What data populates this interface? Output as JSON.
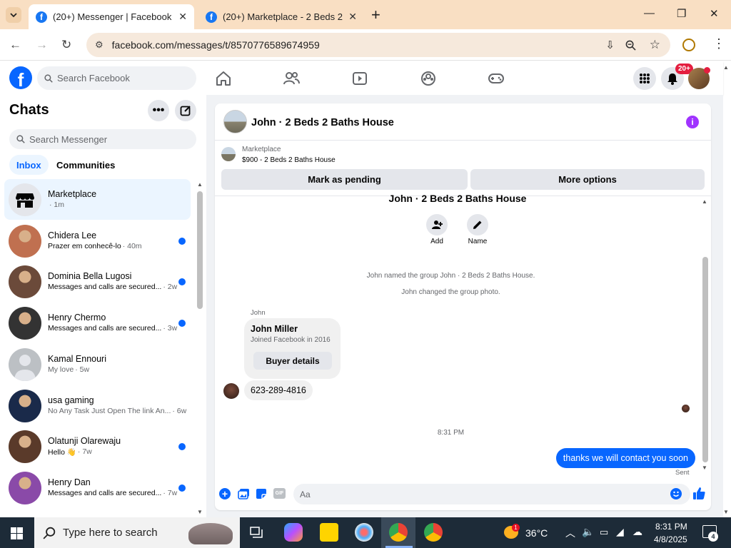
{
  "browser": {
    "tabs": [
      {
        "title": "(20+) Messenger | Facebook",
        "active": true
      },
      {
        "title": "(20+) Marketplace - 2 Beds 2 Ba",
        "active": false
      }
    ],
    "url": "facebook.com/messages/t/8570776589674959"
  },
  "fb": {
    "search_placeholder": "Search Facebook",
    "notification_badge": "20+",
    "brand_color": "#0866ff"
  },
  "sidebar": {
    "title": "Chats",
    "search_placeholder": "Search Messenger",
    "filters": [
      "Inbox",
      "Communities"
    ],
    "chats": [
      {
        "name": "Marketplace",
        "preview": "",
        "time": "· 1m",
        "unread": false,
        "selected": true,
        "avatar": "store-icon"
      },
      {
        "name": "Chidera Lee",
        "preview": "Prazer em conhecê-lo",
        "time": "· 40m",
        "unread": true,
        "selected": false,
        "avatar": "photo"
      },
      {
        "name": "Dominia Bella Lugosi",
        "preview": "Messages and calls are secured...",
        "time": "· 2w",
        "unread": true,
        "selected": false,
        "avatar": "photo"
      },
      {
        "name": "Henry Chermo",
        "preview": "Messages and calls are secured...",
        "time": "· 3w",
        "unread": true,
        "selected": false,
        "avatar": "photo"
      },
      {
        "name": "Kamal Ennouri",
        "preview": "My love",
        "time": "· 5w",
        "unread": false,
        "selected": false,
        "avatar": "default"
      },
      {
        "name": "usa gaming",
        "preview": "No Any Task Just Open The link An...",
        "time": "· 6w",
        "unread": false,
        "selected": false,
        "avatar": "photo"
      },
      {
        "name": "Olatunji Olarewaju",
        "preview": "Hello 👋",
        "time": "· 7w",
        "unread": true,
        "selected": false,
        "avatar": "photo"
      },
      {
        "name": "Henry Dan",
        "preview": "Messages and calls are secured...",
        "time": "· 7w",
        "unread": true,
        "selected": false,
        "avatar": "photo"
      }
    ]
  },
  "conversation": {
    "title": "John · 2 Beds 2 Baths House",
    "marketplace_label": "Marketplace",
    "listing": "$900 - 2 Beds 2 Baths House",
    "mark_pending": "Mark as pending",
    "more_options": "More options",
    "group_title": "John · 2 Beds 2 Baths House",
    "actions": [
      {
        "label": "Add"
      },
      {
        "label": "Name"
      }
    ],
    "system_messages": [
      "John named the group John · 2 Beds 2 Baths House.",
      "John changed the group photo."
    ],
    "sender_name": "John",
    "card": {
      "name": "John Miller",
      "sub": "Joined Facebook in 2016",
      "button": "Buyer details"
    },
    "phone_message": "623-289-4816",
    "timestamp": "8:31 PM",
    "outgoing_message": "thanks we will contact you soon",
    "outgoing_status": "Sent",
    "composer_placeholder": "Aa"
  },
  "taskbar": {
    "search_placeholder": "Type here to search",
    "weather_temp": "36°C",
    "weather_badge": "1",
    "time": "8:31 PM",
    "date": "4/8/2025",
    "notification_count": "4"
  }
}
